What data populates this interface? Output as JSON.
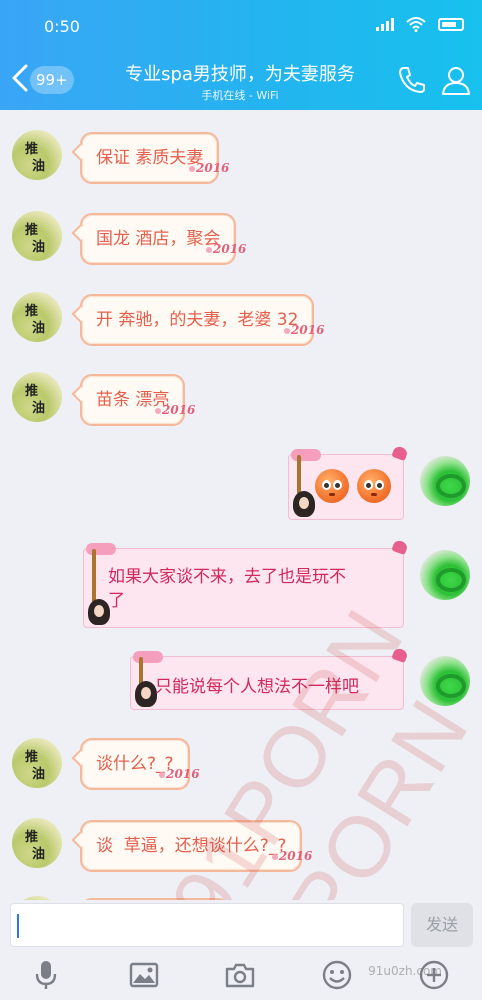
{
  "status": {
    "time": "0:50"
  },
  "header": {
    "unread_badge": "99+",
    "title": "专业spa男技师，为夫妻服务",
    "subtitle": "手机在线 - WiFi"
  },
  "contact_avatar_text": [
    "推",
    "油"
  ],
  "bubble_deco": "2016",
  "messages": [
    {
      "side": "left",
      "text": "保证 素质夫妻"
    },
    {
      "side": "left",
      "text": "国龙 酒店，聚会"
    },
    {
      "side": "left",
      "text": "开 奔驰，的夫妻，老婆 32"
    },
    {
      "side": "left",
      "text": "苗条 漂亮"
    },
    {
      "side": "right",
      "type": "emoji",
      "emoji": [
        "rolling-eyes-emoji",
        "rolling-eyes-emoji"
      ]
    },
    {
      "side": "right",
      "text_line1": "如果大家谈不来，去了也是玩不",
      "text_line2": "了"
    },
    {
      "side": "right",
      "text": "只能说每个人想法不一样吧"
    },
    {
      "side": "left",
      "text": "谈什么?_?"
    },
    {
      "side": "left",
      "text": "谈  草逼，还想谈什么?_?"
    }
  ],
  "input": {
    "value": "",
    "send_label": "发送"
  },
  "toolbar": {
    "items": [
      "microphone-icon",
      "image-icon",
      "camera-icon",
      "emoji-icon",
      "plus-icon"
    ]
  },
  "watermark": {
    "text1": "91PORN",
    "text2": "91PORN",
    "site": "91u0zh.com"
  },
  "colors": {
    "header_start": "#3aa5f6",
    "header_end": "#17c1ee",
    "left_text": "#e4604c",
    "right_text": "#d2285c"
  }
}
